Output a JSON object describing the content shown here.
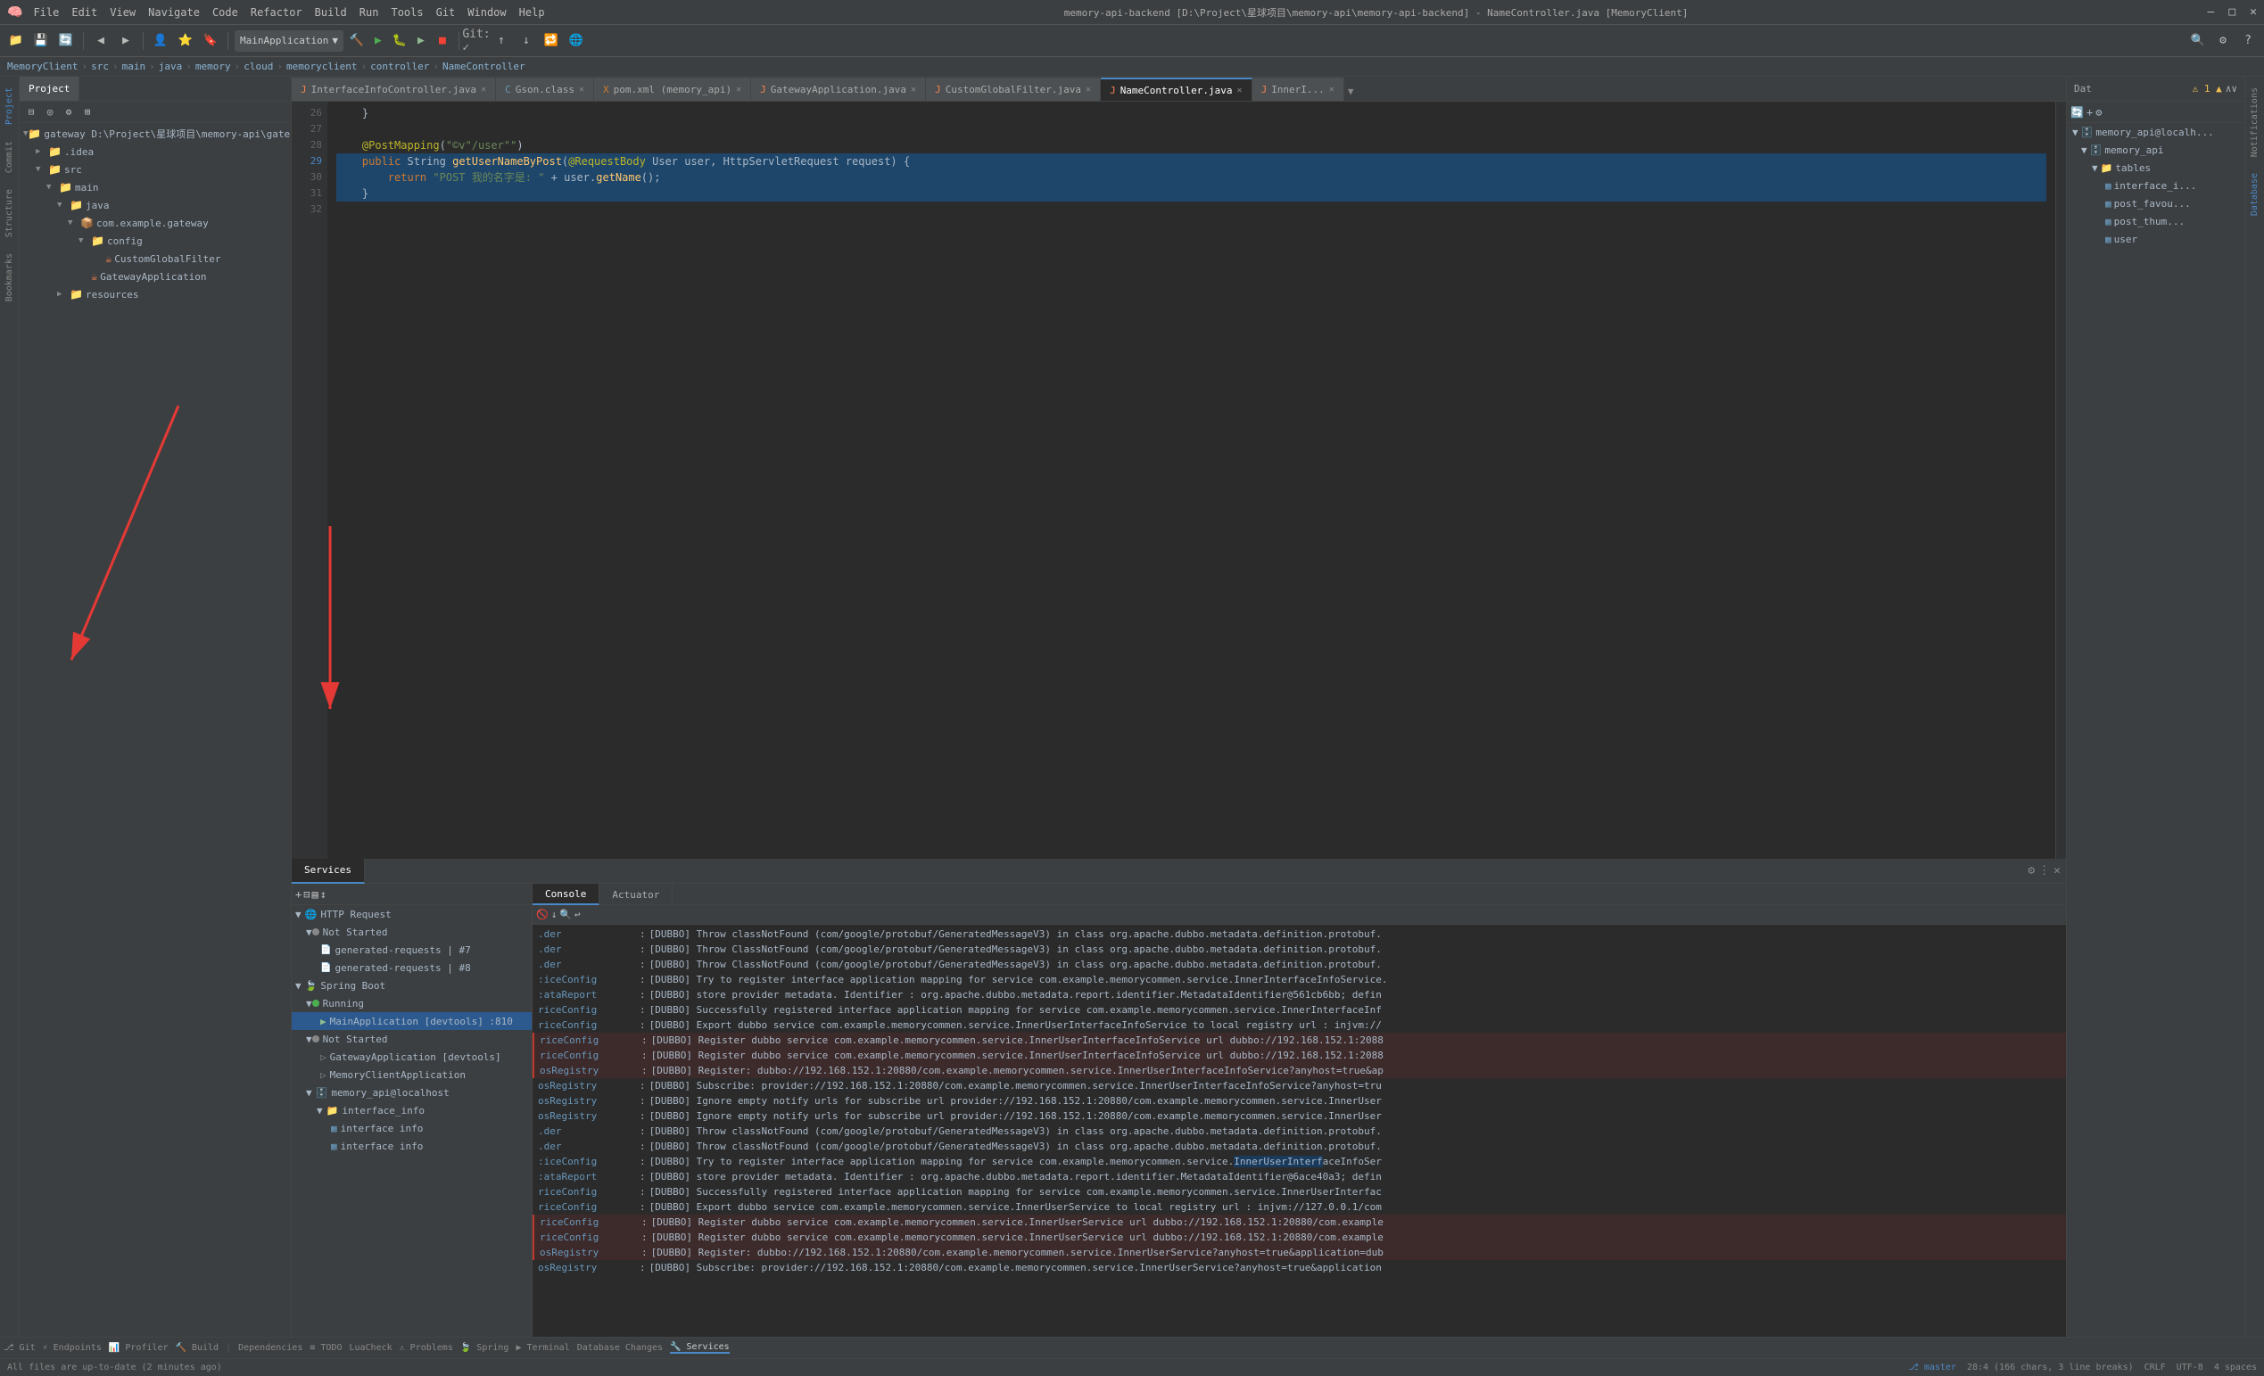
{
  "titleBar": {
    "appName": "MemoryClient",
    "menus": [
      "File",
      "Edit",
      "View",
      "Navigate",
      "Code",
      "Refactor",
      "Build",
      "Run",
      "Tools",
      "Git",
      "Window",
      "Help"
    ],
    "title": "memory-api-backend [D:\\Project\\星球项目\\memory-api\\memory-api-backend] - NameController.java [MemoryClient]",
    "controls": [
      "—",
      "□",
      "✕"
    ],
    "runConfig": "MainApplication"
  },
  "breadcrumb": {
    "parts": [
      "MemoryClient",
      "src",
      "main",
      "java",
      "memory",
      "cloud",
      "memoryclient",
      "controller",
      "NameController"
    ]
  },
  "editorTabs": [
    {
      "label": "InterfaceInfoController.java",
      "active": false,
      "icon": "J"
    },
    {
      "label": "Gson.class",
      "active": false,
      "icon": "C"
    },
    {
      "label": "pom.xml (memory_api)",
      "active": false,
      "icon": "X"
    },
    {
      "label": "GatewayApplication.java",
      "active": false,
      "icon": "J"
    },
    {
      "label": "CustomGlobalFilter.java",
      "active": false,
      "icon": "J"
    },
    {
      "label": "NameController.java",
      "active": true,
      "icon": "J"
    },
    {
      "label": "InnerI...",
      "active": false,
      "icon": "J"
    }
  ],
  "codeLines": [
    {
      "num": "26",
      "text": "    }",
      "highlight": false
    },
    {
      "num": "27",
      "text": "",
      "highlight": false
    },
    {
      "num": "28",
      "text": "    @PostMapping(\"©v\\\"/user\\\"\")",
      "highlight": false
    },
    {
      "num": "29",
      "text": "    public String getUserNameByPost(@RequestBody User user, HttpServletRequest request) {",
      "highlight": true
    },
    {
      "num": "30",
      "text": "        return \"POST 我的名字是: \" + user.getName();",
      "highlight": true
    },
    {
      "num": "31",
      "text": "    }",
      "highlight": true
    },
    {
      "num": "32",
      "text": "",
      "highlight": false
    }
  ],
  "projectTree": {
    "title": "Project",
    "items": [
      {
        "label": "gateway D:\\Project\\星球项目\\memory-api\\gateway",
        "indent": 0,
        "type": "folder",
        "arrow": "▼"
      },
      {
        "label": ".idea",
        "indent": 1,
        "type": "folder",
        "arrow": "▶"
      },
      {
        "label": "src",
        "indent": 1,
        "type": "folder",
        "arrow": "▼"
      },
      {
        "label": "main",
        "indent": 2,
        "type": "folder",
        "arrow": "▼"
      },
      {
        "label": "java",
        "indent": 3,
        "type": "folder",
        "arrow": "▼"
      },
      {
        "label": "com.example.gateway",
        "indent": 4,
        "type": "package",
        "arrow": "▼"
      },
      {
        "label": "config",
        "indent": 5,
        "type": "folder",
        "arrow": "▼"
      },
      {
        "label": "CustomGlobalFilter",
        "indent": 6,
        "type": "java",
        "arrow": ""
      },
      {
        "label": "GatewayApplication",
        "indent": 6,
        "type": "java",
        "arrow": ""
      },
      {
        "label": "resources",
        "indent": 3,
        "type": "folder",
        "arrow": "▶"
      }
    ]
  },
  "servicesPanel": {
    "title": "Services",
    "tabs": [
      "Console",
      "Actuator"
    ],
    "activeTab": "Console",
    "tree": [
      {
        "label": "HTTP Request",
        "indent": 0,
        "type": "folder",
        "arrow": "▼",
        "status": ""
      },
      {
        "label": "Not Started",
        "indent": 1,
        "type": "group",
        "arrow": "▼",
        "status": "not-started"
      },
      {
        "label": "generated-requests | #7",
        "indent": 2,
        "type": "item",
        "arrow": "",
        "status": ""
      },
      {
        "label": "generated-requests | #8",
        "indent": 2,
        "type": "item",
        "arrow": "",
        "status": ""
      },
      {
        "label": "Spring Boot",
        "indent": 0,
        "type": "folder",
        "arrow": "▼",
        "status": ""
      },
      {
        "label": "Running",
        "indent": 1,
        "type": "group",
        "arrow": "▼",
        "status": "running"
      },
      {
        "label": "MainApplication [devtools] :810",
        "indent": 2,
        "type": "java",
        "arrow": "",
        "status": "selected"
      },
      {
        "label": "Not Started",
        "indent": 1,
        "type": "group",
        "arrow": "▼",
        "status": "not-started"
      },
      {
        "label": "GatewayApplication [devtools]",
        "indent": 2,
        "type": "item",
        "arrow": "",
        "status": ""
      },
      {
        "label": "MemoryClientApplication",
        "indent": 2,
        "type": "item",
        "arrow": "",
        "status": ""
      },
      {
        "label": "memory_api@localhost",
        "indent": 1,
        "type": "db",
        "arrow": "▼",
        "status": ""
      },
      {
        "label": "interface_info",
        "indent": 2,
        "type": "folder",
        "arrow": "▼",
        "status": ""
      },
      {
        "label": "interface info",
        "indent": 3,
        "type": "table",
        "arrow": "",
        "status": ""
      },
      {
        "label": "interface info",
        "indent": 3,
        "type": "table",
        "arrow": "",
        "status": ""
      }
    ]
  },
  "logLines": [
    {
      "prefix": ".der",
      "text": "[DUBBO] Throw classNotFound (com/google/protobuf/GeneratedMessageV3) in class org.apache.dubbo.metadata.definition.protobuf.",
      "highlight": false
    },
    {
      "prefix": ".der",
      "text": "[DUBBO] Throw classNotFound (com/google/protobuf/GeneratedMessageV3) in class org.apache.dubbo.metadata.definition.protobuf.",
      "highlight": false
    },
    {
      "prefix": ".der",
      "text": "[DUBBO] Throw classNotFound (com/google/protobuf/GeneratedMessageV3) in class org.apache.dubbo.metadata.definition.protobuf.",
      "highlight": false
    },
    {
      "prefix": "viceConfig",
      "text": "[DUBBO] Try to register interface application mapping for service com.example.memorycommen.service.InnerInterfaceInfoService.",
      "highlight": false
    },
    {
      "prefix": "atadataReport",
      "text": "[DUBBO] store provider metadata. Identifier : org.apache.dubbo.metadata.report.identifier.MetadataIdentifier@561cb6bb; defin",
      "highlight": false
    },
    {
      "prefix": "riceConfig",
      "text": "[DUBBO] Successfully registered interface application mapping for service com.example.memorycommen.service.InnerInterfaceInf",
      "highlight": false
    },
    {
      "prefix": "riceConfig",
      "text": "[DUBBO] Export dubbo service com.example.memorycommen.service.InnerUserInterfaceInfoService to local registry url : injvm://",
      "highlight": false
    },
    {
      "prefix": "riceConfig",
      "text": "[DUBBO] Register dubbo service com.example.memorycommen.service.InnerUserInterfaceInfoService url dubbo://192.168.152.1:2088",
      "highlight": true
    },
    {
      "prefix": "riceConfig",
      "text": "[DUBBO] Register dubbo service com.example.memorycommen.service.InnerUserInterfaceInfoService url dubbo://192.168.152.1:2088",
      "highlight": true
    },
    {
      "prefix": "osRegistry",
      "text": "[DUBBO] Register: dubbo://192.168.152.1:20880/com.example.memorycommen.service.InnerUserInterfaceInfoService?anyhost=true&ap",
      "highlight": true
    },
    {
      "prefix": "osRegistry",
      "text": "[DUBBO] Subscribe: provider://192.168.152.1:20880/com.example.memorycommen.service.InnerUserInterfaceInfoService?anyhost=tru",
      "highlight": false
    },
    {
      "prefix": "osRegistry",
      "text": "[DUBBO] Ignore empty notify urls for subscribe url provider://192.168.152.1:20880/com.example.memorycommen.service.InnerUser",
      "highlight": false
    },
    {
      "prefix": "osRegistry",
      "text": "[DUBBO] Ignore empty notify urls for subscribe url provider://192.168.152.1:20880/com.example.memorycommen.service.InnerUser",
      "highlight": false
    },
    {
      "prefix": ".der",
      "text": "[DUBBO] Throw classNotFound (com/google/protobuf/GeneratedMessageV3) in class org.apache.dubbo.metadata.definition.protobuf.",
      "highlight": false
    },
    {
      "prefix": ".der",
      "text": "[DUBBO] Throw classNotFound (com/google/protobuf/GeneratedMessageV3) in class org.apache.dubbo.metadata.definition.protobuf.",
      "highlight": false
    },
    {
      "prefix": "viceConfig",
      "text": "[DUBBO] Try to register interface application mapping for service com.example.memorycommen.service.InnerUserInterfaceInfoSer",
      "highlight": false,
      "selected": true
    },
    {
      "prefix": "atadataReport",
      "text": "[DUBBO] store provider metadata. Identifier : org.apache.dubbo.metadata.report.identifier.MetadataIdentifier@6ace40a3; defin",
      "highlight": false
    },
    {
      "prefix": "riceConfig",
      "text": "[DUBBO] Successfully registered interface application mapping for service com.example.memorycommen.service.InnerUserInterfac",
      "highlight": false
    },
    {
      "prefix": "riceConfig",
      "text": "[DUBBO] Export dubbo service com.example.memorycommen.service.InnerUserService to local registry url : injvm://127.0.0.1/com",
      "highlight": false
    },
    {
      "prefix": "riceConfig",
      "text": "[DUBBO] Register dubbo service com.example.memorycommen.service.InnerUserService url dubbo://192.168.152.1:20880/com.example",
      "highlight": true
    },
    {
      "prefix": "riceConfig",
      "text": "[DUBBO] Register dubbo service com.example.memorycommen.service.InnerUserService url dubbo://192.168.152.1:20880/com.example",
      "highlight": true
    },
    {
      "prefix": "osRegistry",
      "text": "[DUBBO] Register: dubbo://192.168.152.1:20880/com.example.memorycommen.service.InnerUserService?anyhost=true&application=dub",
      "highlight": true
    },
    {
      "prefix": "osRegistry",
      "text": "[DUBBO] Subscribe: provider://192.168.152.1:20880/com.example.memorycommen.service.InnerUserService?anyhost=true&application",
      "highlight": false
    }
  ],
  "rightSidebar": {
    "title": "Dat",
    "dbTree": [
      {
        "label": "memory_api@localh...",
        "indent": 0,
        "type": "db",
        "arrow": "▼"
      },
      {
        "label": "memory_api",
        "indent": 1,
        "type": "db",
        "arrow": "▼"
      },
      {
        "label": "tables",
        "indent": 2,
        "type": "folder",
        "arrow": "▼"
      },
      {
        "label": "interface_i...",
        "indent": 3,
        "type": "table",
        "arrow": ""
      },
      {
        "label": "post_favou...",
        "indent": 3,
        "type": "table",
        "arrow": ""
      },
      {
        "label": "post_thum...",
        "indent": 3,
        "type": "table",
        "arrow": ""
      },
      {
        "label": "user",
        "indent": 3,
        "type": "table",
        "arrow": ""
      }
    ]
  },
  "statusBar": {
    "git": "⎇ master",
    "items": [
      "28:4 (166 chars, 3 line breaks)",
      "CRLF",
      "UTF-8",
      "4 spaces"
    ],
    "leftItems": [
      "⚠ 1 ▲",
      "Git",
      "Endpoints",
      "Profiler",
      "Build",
      "Dependencies",
      "TODO",
      "LuaCheck",
      "Problems",
      "Spring",
      "Terminal",
      "Database Changes",
      "Services"
    ],
    "allFilesMsg": "All files are up-to-date (2 minutes ago)"
  },
  "edgeLabels": {
    "left": [
      "Project",
      "Commit",
      "Structure",
      "Bookmarks"
    ],
    "right": [
      "Notifications",
      "Database"
    ]
  }
}
